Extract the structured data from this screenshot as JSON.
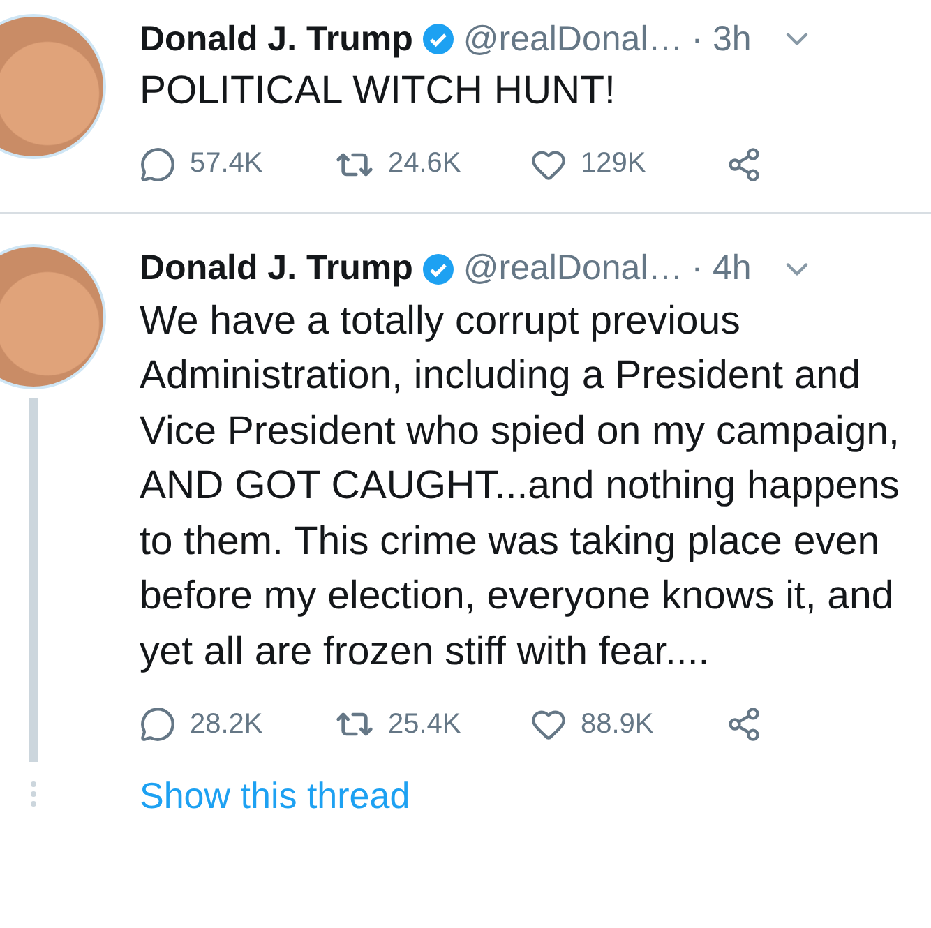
{
  "tweets": [
    {
      "author": "Donald J. Trump",
      "verified": true,
      "handle": "@realDonal…",
      "time": "· 3h",
      "text": "POLITICAL WITCH HUNT!",
      "replies": "57.4K",
      "retweets": "24.6K",
      "likes": "129K"
    },
    {
      "author": "Donald J. Trump",
      "verified": true,
      "handle": "@realDonal…",
      "time": "· 4h",
      "text": "We have a totally corrupt previous Administration, including a President and Vice President who spied on my campaign, AND GOT CAUGHT...and nothing happens to them. This crime was taking place even before my election, everyone knows it, and yet all are frozen stiff with fear....",
      "replies": "28.2K",
      "retweets": "25.4K",
      "likes": "88.9K",
      "show_thread": "Show this thread"
    }
  ]
}
